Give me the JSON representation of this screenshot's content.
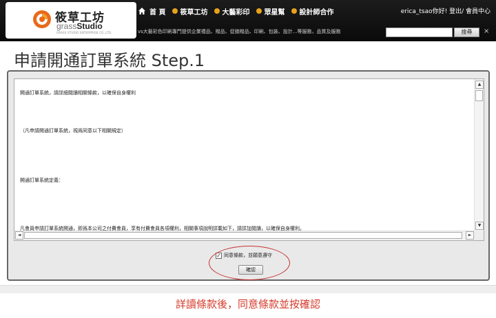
{
  "header": {
    "logo_cn": "筱草工坊",
    "logo_en_light": "grass",
    "logo_en_bold": "Studio",
    "logo_sub": "GRASS STUDIO ENTERPRISE CO.,LTD.",
    "nav": [
      {
        "label": "首 頁",
        "icon": "home-icon"
      },
      {
        "label": "筱草工坊",
        "icon": "orange-dot-icon"
      },
      {
        "label": "大藝彩印",
        "icon": "orange-dot-icon"
      },
      {
        "label": "眾星幫",
        "icon": "orange-dot-icon"
      },
      {
        "label": "設計師合作",
        "icon": "orange-dot-icon"
      }
    ],
    "user_greeting": "erica_tsao你好! 登出/ 會員中心",
    "ticker": "vs大藝彩色印刷專門提供企業禮品、贈品、促銷贈品、印刷、包裝、設計...等服務，品質及服務",
    "search_placeholder": "",
    "search_button": "搜尋",
    "close": "×"
  },
  "page": {
    "title": "申請開通訂單系統 Step.1"
  },
  "terms": {
    "lines": [
      "開通訂單系統，請詳細閱讀相關條款，以確保自身權利",
      "（凡申請開通訂單系統，視爲同意以下相關規定）",
      "開通訂單系統定義：",
      "凡會員申請訂單系統開通，即爲本公司之付費會員，享有付費會員各項權利，相關事項說明詳載如下，請詳加閱讀，以確保自身權利。"
    ],
    "scroll_up": "▲",
    "scroll_down": "▼",
    "scroll_left": "◄",
    "scroll_right": "►"
  },
  "agreement": {
    "checkbox_label": "同意條款，並願意遵守",
    "checked": true,
    "confirm_button": "確認"
  },
  "instruction": "詳讀條款後，同意條款並按確認",
  "colors": {
    "header_bg": "#111111",
    "nav_accent": "#e8a21a",
    "highlight": "#c83232",
    "instruction": "#d43a2a"
  }
}
